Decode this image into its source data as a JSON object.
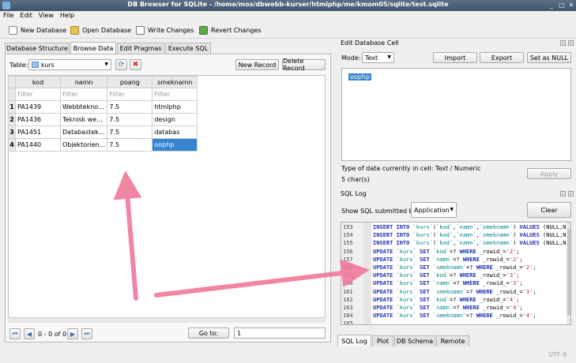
{
  "window": {
    "title": "DB Browser for SQLite - /home/mos/dbwebb-kurser/htmlphp/me/kmom05/sqlite/test.sqlite",
    "min": "_",
    "max": "□",
    "close": "✕"
  },
  "menu": [
    "File",
    "Edit",
    "View",
    "Help"
  ],
  "toolbar": {
    "new_db": "New Database",
    "open_db": "Open Database",
    "write": "Write Changes",
    "revert": "Revert Changes"
  },
  "tabs": [
    "Database Structure",
    "Browse Data",
    "Edit Pragmas",
    "Execute SQL"
  ],
  "browse": {
    "table_label": "Table:",
    "table_value": "kurs",
    "new_record": "New Record",
    "delete_record": "Delete Record",
    "columns": [
      "kod",
      "namn",
      "poang",
      "smeknamn"
    ],
    "filter_placeholder": "Filter",
    "rows": [
      {
        "n": "1",
        "cells": [
          "PA1439",
          "Webbtekno...",
          "7.5",
          "htmlphp"
        ]
      },
      {
        "n": "2",
        "cells": [
          "PA1436",
          "Teknisk we...",
          "7.5",
          "design"
        ]
      },
      {
        "n": "3",
        "cells": [
          "PA1451",
          "Databastek...",
          "7.5",
          "databas"
        ]
      },
      {
        "n": "4",
        "cells": [
          "PA1440",
          "Objektorien...",
          "7.5",
          "oophp"
        ]
      }
    ],
    "nav_status": "0 - 0 of 0",
    "goto_label": "Go to:",
    "goto_value": "1"
  },
  "edit_cell": {
    "title": "Edit Database Cell",
    "mode_label": "Mode:",
    "mode_value": "Text",
    "import": "Import",
    "export": "Export",
    "set_null": "Set as NULL",
    "content": "oophp",
    "type_info": "Type of data currently in cell: Text / Numeric",
    "chars": "5 char(s)",
    "apply": "Apply"
  },
  "sql_log": {
    "title": "SQL Log",
    "show_label": "Show SQL submitted by",
    "source_value": "Application",
    "clear": "Clear",
    "lines": [
      {
        "n": "153",
        "parts": [
          [
            "kw",
            "INSERT INTO "
          ],
          [
            "tk",
            "`kurs`"
          ],
          [
            "",
            "("
          ],
          [
            "tk",
            "`kod`"
          ],
          [
            "",
            ","
          ],
          [
            "tk",
            "`namn`"
          ],
          [
            "",
            ","
          ],
          [
            "tk",
            "`smeknamn`"
          ],
          [
            "",
            ") "
          ],
          [
            "kw",
            "VALUES "
          ],
          [
            "",
            "(NULL,N"
          ]
        ]
      },
      {
        "n": "154",
        "parts": [
          [
            "kw",
            "INSERT INTO "
          ],
          [
            "tk",
            "`kurs`"
          ],
          [
            "",
            "("
          ],
          [
            "tk",
            "`kod`"
          ],
          [
            "",
            ","
          ],
          [
            "tk",
            "`namn`"
          ],
          [
            "",
            ","
          ],
          [
            "tk",
            "`smeknamn`"
          ],
          [
            "",
            ") "
          ],
          [
            "kw",
            "VALUES "
          ],
          [
            "",
            "(NULL,N"
          ]
        ]
      },
      {
        "n": "155",
        "parts": [
          [
            "kw",
            "INSERT INTO "
          ],
          [
            "tk",
            "`kurs`"
          ],
          [
            "",
            "("
          ],
          [
            "tk",
            "`kod`"
          ],
          [
            "",
            ","
          ],
          [
            "tk",
            "`namn`"
          ],
          [
            "",
            ","
          ],
          [
            "tk",
            "`smeknamn`"
          ],
          [
            "",
            ") "
          ],
          [
            "kw",
            "VALUES "
          ],
          [
            "",
            "(NULL,N"
          ]
        ]
      },
      {
        "n": "156",
        "parts": [
          [
            "kw",
            "UPDATE "
          ],
          [
            "tk",
            "`kurs` "
          ],
          [
            "kw",
            "SET "
          ],
          [
            "tk",
            "`kod`"
          ],
          [
            "",
            "=? "
          ],
          [
            "kw",
            "WHERE "
          ],
          [
            "",
            "_rowid_="
          ],
          [
            "st",
            "'2'"
          ],
          [
            "",
            ";"
          ]
        ]
      },
      {
        "n": "157",
        "parts": [
          [
            "kw",
            "UPDATE "
          ],
          [
            "tk",
            "`kurs` "
          ],
          [
            "kw",
            "SET "
          ],
          [
            "tk",
            "`namn`"
          ],
          [
            "",
            "=? "
          ],
          [
            "kw",
            "WHERE "
          ],
          [
            "",
            "_rowid_="
          ],
          [
            "st",
            "'2'"
          ],
          [
            "",
            ";"
          ]
        ]
      },
      {
        "n": "158",
        "parts": [
          [
            "kw",
            "UPDATE "
          ],
          [
            "tk",
            "`kurs` "
          ],
          [
            "kw",
            "SET "
          ],
          [
            "tk",
            "`smeknamn`"
          ],
          [
            "",
            "=? "
          ],
          [
            "kw",
            "WHERE "
          ],
          [
            "",
            "_rowid_="
          ],
          [
            "st",
            "'2'"
          ],
          [
            "",
            ";"
          ]
        ]
      },
      {
        "n": "159",
        "parts": [
          [
            "kw",
            "UPDATE "
          ],
          [
            "tk",
            "`kurs` "
          ],
          [
            "kw",
            "SET "
          ],
          [
            "tk",
            "`kod`"
          ],
          [
            "",
            "=? "
          ],
          [
            "kw",
            "WHERE "
          ],
          [
            "",
            "_rowid_="
          ],
          [
            "st",
            "'3'"
          ],
          [
            "",
            ";"
          ]
        ]
      },
      {
        "n": "160",
        "parts": [
          [
            "kw",
            "UPDATE "
          ],
          [
            "tk",
            "`kurs` "
          ],
          [
            "kw",
            "SET "
          ],
          [
            "tk",
            "`namn`"
          ],
          [
            "",
            "=? "
          ],
          [
            "kw",
            "WHERE "
          ],
          [
            "",
            "_rowid_="
          ],
          [
            "st",
            "'3'"
          ],
          [
            "",
            ";"
          ]
        ]
      },
      {
        "n": "161",
        "parts": [
          [
            "kw",
            "UPDATE "
          ],
          [
            "tk",
            "`kurs` "
          ],
          [
            "kw",
            "SET "
          ],
          [
            "tk",
            "`smeknamn`"
          ],
          [
            "",
            "=? "
          ],
          [
            "kw",
            "WHERE "
          ],
          [
            "",
            "_rowid_="
          ],
          [
            "st",
            "'3'"
          ],
          [
            "",
            ";"
          ]
        ]
      },
      {
        "n": "162",
        "parts": [
          [
            "kw",
            "UPDATE "
          ],
          [
            "tk",
            "`kurs` "
          ],
          [
            "kw",
            "SET "
          ],
          [
            "tk",
            "`kod`"
          ],
          [
            "",
            "=? "
          ],
          [
            "kw",
            "WHERE "
          ],
          [
            "",
            "_rowid_="
          ],
          [
            "st",
            "'4'"
          ],
          [
            "",
            ";"
          ]
        ]
      },
      {
        "n": "163",
        "parts": [
          [
            "kw",
            "UPDATE "
          ],
          [
            "tk",
            "`kurs` "
          ],
          [
            "kw",
            "SET "
          ],
          [
            "tk",
            "`namn`"
          ],
          [
            "",
            "=? "
          ],
          [
            "kw",
            "WHERE "
          ],
          [
            "",
            "_rowid_="
          ],
          [
            "st",
            "'4'"
          ],
          [
            "",
            ";"
          ]
        ]
      },
      {
        "n": "164",
        "parts": [
          [
            "kw",
            "UPDATE "
          ],
          [
            "tk",
            "`kurs` "
          ],
          [
            "kw",
            "SET "
          ],
          [
            "tk",
            "`smeknamn`"
          ],
          [
            "",
            "=? "
          ],
          [
            "kw",
            "WHERE "
          ],
          [
            "",
            "_rowid_="
          ],
          [
            "st",
            "'4'"
          ],
          [
            "",
            ";"
          ]
        ]
      },
      {
        "n": "165",
        "parts": []
      }
    ]
  },
  "bottom_tabs": [
    "SQL Log",
    "Plot",
    "DB Schema",
    "Remote"
  ],
  "status": {
    "encoding": "UTF-8"
  },
  "colors": {
    "selection": "#3584cf",
    "annotation_arrow": "#f07a9a",
    "keyword": "#1d2fb0"
  }
}
